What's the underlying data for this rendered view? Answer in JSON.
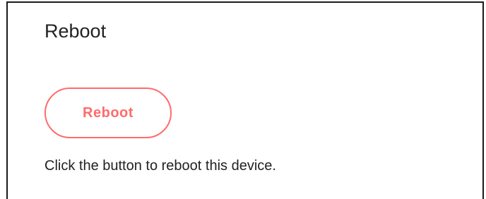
{
  "section": {
    "title": "Reboot",
    "button_label": "Reboot",
    "description": "Click the button to reboot this device."
  },
  "colors": {
    "accent": "#ff6b6b",
    "text": "#222222",
    "border": "#1a1a1a"
  }
}
